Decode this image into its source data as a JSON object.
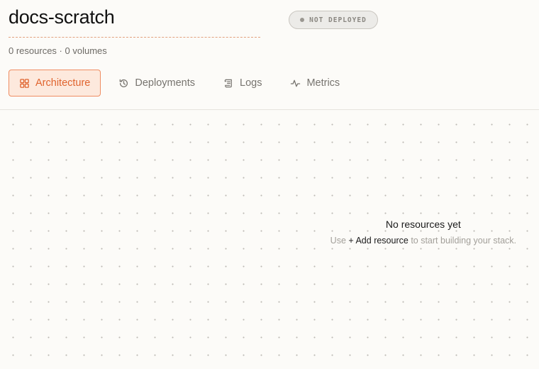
{
  "project": {
    "title": "docs-scratch",
    "status": "NOT DEPLOYED",
    "resources": "0 resources",
    "separator": "·",
    "volumes": "0 volumes"
  },
  "tabs": [
    {
      "label": "Architecture",
      "icon": "grid-icon",
      "active": true
    },
    {
      "label": "Deployments",
      "icon": "history-icon",
      "active": false
    },
    {
      "label": "Logs",
      "icon": "scroll-icon",
      "active": false
    },
    {
      "label": "Metrics",
      "icon": "activity-icon",
      "active": false
    }
  ],
  "empty_state": {
    "title": "No resources yet",
    "hint_prefix": "Use",
    "link_label": "+ Add resource",
    "hint_suffix": "to start building your stack."
  },
  "colors": {
    "accent": "#e0642e",
    "accent_bg": "#fde9dd",
    "background": "#fcfbf8"
  }
}
